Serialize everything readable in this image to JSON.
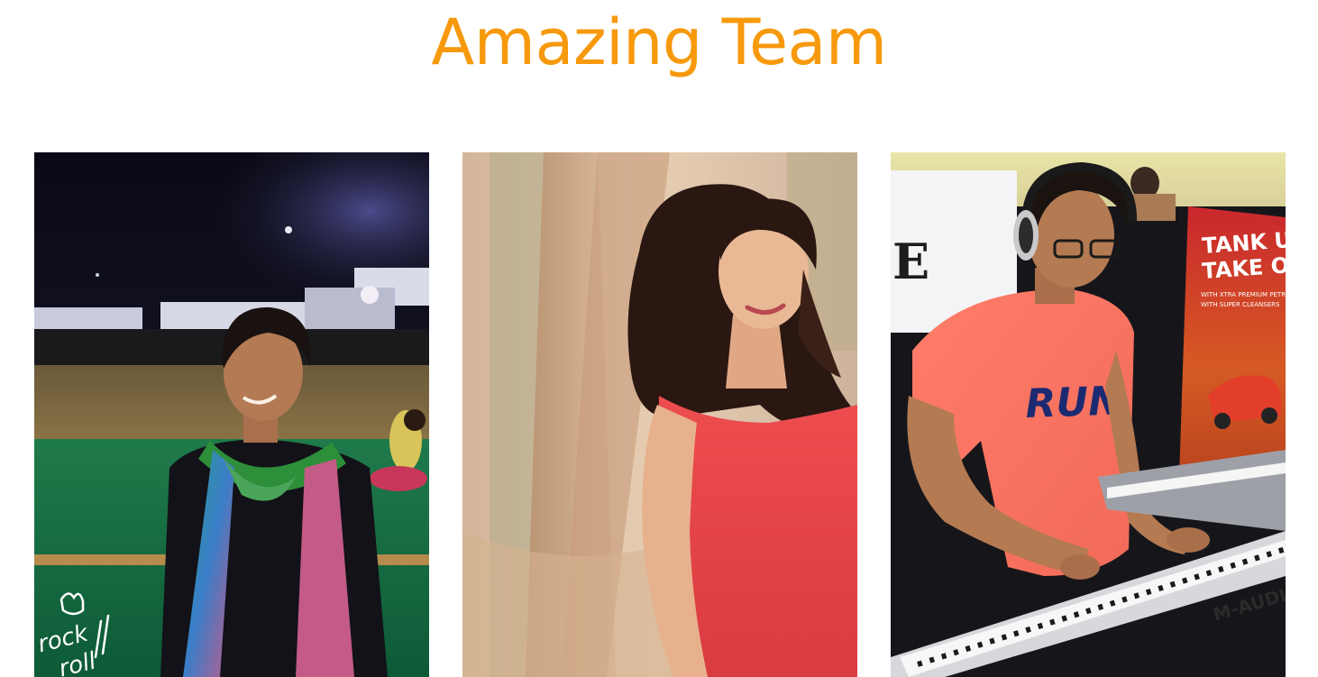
{
  "section": {
    "title": "Amazing Team",
    "title_color": "#f7990c"
  },
  "team": [
    {
      "photo": "team-member-photo-1",
      "watermark_lines": [
        "rock",
        "roll"
      ]
    },
    {
      "photo": "team-member-photo-2"
    },
    {
      "photo": "team-member-photo-3",
      "banner_lines": [
        "TANK UP &",
        "TAKE OFF"
      ],
      "banner_small_lines": [
        "WITH XTRA PREMIUM PETROL",
        "WITH SUPER CLEANSERS"
      ],
      "poster_letter": "E",
      "shirt_text": "RUN",
      "keyboard_brand": "M-AUDIO"
    }
  ]
}
